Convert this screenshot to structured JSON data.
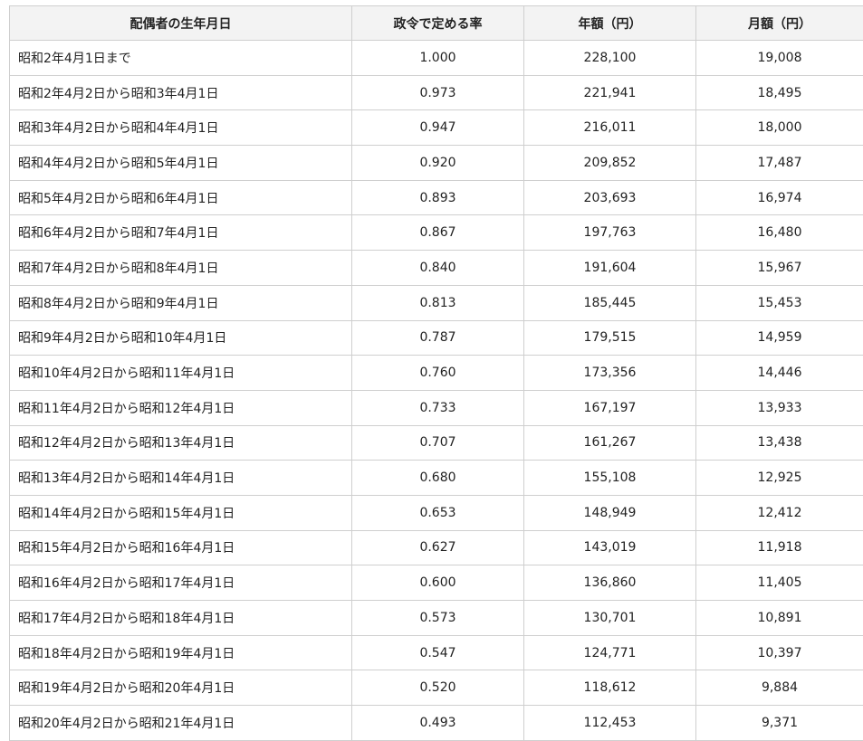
{
  "headers": [
    "配偶者の生年月日",
    "政令で定める率",
    "年額（円）",
    "月額（円）"
  ],
  "rows": [
    [
      "昭和2年4月1日まで",
      "1.000",
      "228,100",
      "19,008"
    ],
    [
      "昭和2年4月2日から昭和3年4月1日",
      "0.973",
      "221,941",
      "18,495"
    ],
    [
      "昭和3年4月2日から昭和4年4月1日",
      "0.947",
      "216,011",
      "18,000"
    ],
    [
      "昭和4年4月2日から昭和5年4月1日",
      "0.920",
      "209,852",
      "17,487"
    ],
    [
      "昭和5年4月2日から昭和6年4月1日",
      "0.893",
      "203,693",
      "16,974"
    ],
    [
      "昭和6年4月2日から昭和7年4月1日",
      "0.867",
      "197,763",
      "16,480"
    ],
    [
      "昭和7年4月2日から昭和8年4月1日",
      "0.840",
      "191,604",
      "15,967"
    ],
    [
      "昭和8年4月2日から昭和9年4月1日",
      "0.813",
      "185,445",
      "15,453"
    ],
    [
      "昭和9年4月2日から昭和10年4月1日",
      "0.787",
      "179,515",
      "14,959"
    ],
    [
      "昭和10年4月2日から昭和11年4月1日",
      "0.760",
      "173,356",
      "14,446"
    ],
    [
      "昭和11年4月2日から昭和12年4月1日",
      "0.733",
      "167,197",
      "13,933"
    ],
    [
      "昭和12年4月2日から昭和13年4月1日",
      "0.707",
      "161,267",
      "13,438"
    ],
    [
      "昭和13年4月2日から昭和14年4月1日",
      "0.680",
      "155,108",
      "12,925"
    ],
    [
      "昭和14年4月2日から昭和15年4月1日",
      "0.653",
      "148,949",
      "12,412"
    ],
    [
      "昭和15年4月2日から昭和16年4月1日",
      "0.627",
      "143,019",
      "11,918"
    ],
    [
      "昭和16年4月2日から昭和17年4月1日",
      "0.600",
      "136,860",
      "11,405"
    ],
    [
      "昭和17年4月2日から昭和18年4月1日",
      "0.573",
      "130,701",
      "10,891"
    ],
    [
      "昭和18年4月2日から昭和19年4月1日",
      "0.547",
      "124,771",
      "10,397"
    ],
    [
      "昭和19年4月2日から昭和20年4月1日",
      "0.520",
      "118,612",
      "9,884"
    ],
    [
      "昭和20年4月2日から昭和21年4月1日",
      "0.493",
      "112,453",
      "9,371"
    ]
  ]
}
